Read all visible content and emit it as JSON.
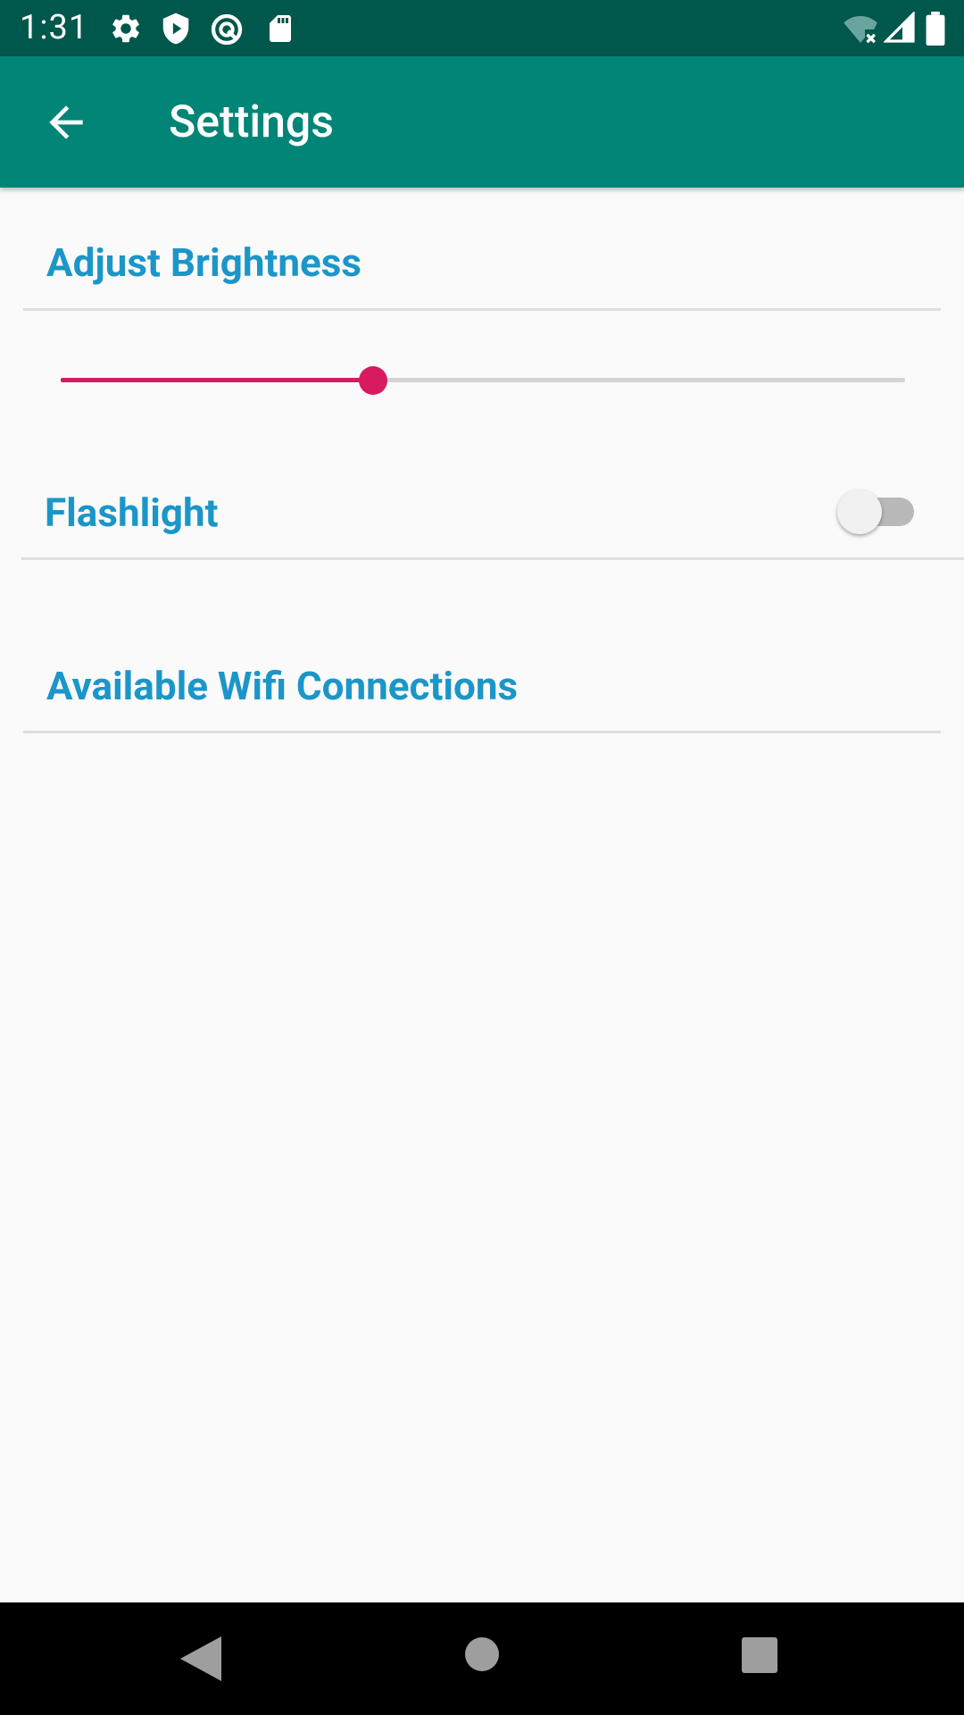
{
  "status_bar": {
    "time": "1:31",
    "icons": [
      "gear-icon",
      "shield-play-icon",
      "vpn-key-icon",
      "sd-card-icon",
      "wifi-off-icon",
      "cell-signal-icon",
      "battery-icon"
    ]
  },
  "app_bar": {
    "title": "Settings",
    "back_icon": "arrow-back-icon"
  },
  "brightness": {
    "title": "Adjust Brightness",
    "slider_value_fraction": 0.37
  },
  "flashlight": {
    "title": "Flashlight",
    "switch_on": false
  },
  "wifi": {
    "title": "Available Wifi Connections"
  },
  "nav_bar": {
    "buttons": [
      "back-triangle-icon",
      "home-circle-icon",
      "recents-square-icon"
    ]
  },
  "colors": {
    "status_bar": "#00574b",
    "app_bar": "#008577",
    "accent_text": "#1b96c8",
    "slider_accent": "#d81b60",
    "background": "#fafafa"
  }
}
